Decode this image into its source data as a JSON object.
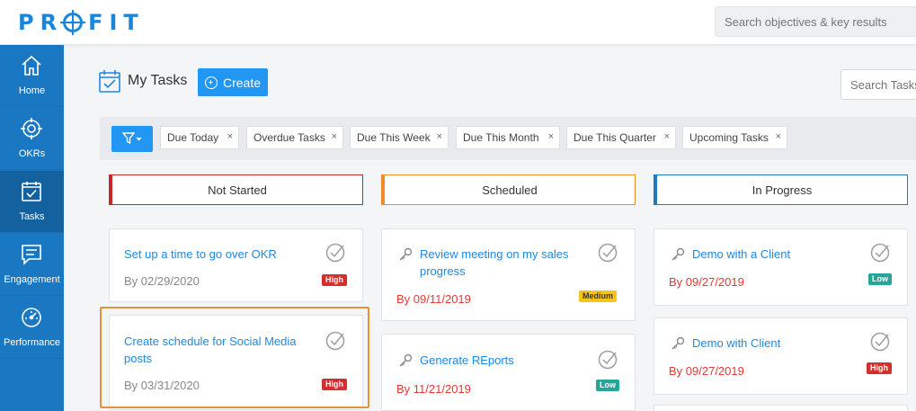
{
  "app": {
    "logo": "PROFIT"
  },
  "topbar": {
    "search_placeholder": "Search objectives & key results"
  },
  "sidebar": {
    "items": [
      {
        "label": "Home",
        "icon": "home-icon"
      },
      {
        "label": "OKRs",
        "icon": "target-icon"
      },
      {
        "label": "Tasks",
        "icon": "tasks-icon"
      },
      {
        "label": "Engagement",
        "icon": "chat-icon"
      },
      {
        "label": "Performance",
        "icon": "gauge-icon"
      }
    ]
  },
  "page": {
    "title": "My Tasks",
    "create_label": "Create",
    "search_placeholder": "Search Tasks"
  },
  "filters": [
    "Due Today",
    "Overdue Tasks",
    "Due This Week",
    "Due This Month",
    "Due This Quarter",
    "Upcoming Tasks"
  ],
  "filter_remove": "×",
  "columns": [
    {
      "name": "Not Started",
      "color": "#c62828"
    },
    {
      "name": "Scheduled",
      "color": "#ef8c2a"
    },
    {
      "name": "In Progress",
      "color": "#1e7bc2"
    }
  ],
  "cards": {
    "not_started": [
      {
        "title": "Set up a time to go over OKR",
        "date": "By 02/29/2020",
        "priority": "High"
      },
      {
        "title": "Create schedule for Social Media posts",
        "date": "By 03/31/2020",
        "priority": "High"
      }
    ],
    "scheduled": [
      {
        "title": "Review meeting on my sales progress",
        "date": "By 09/11/2019",
        "priority": "Medium"
      },
      {
        "title": "Generate REports",
        "date": "By 11/21/2019",
        "priority": "Low"
      }
    ],
    "in_progress": [
      {
        "title": "Demo with a Client",
        "date": "By 09/27/2019",
        "priority": "Low"
      },
      {
        "title": "Demo with Client",
        "date": "By 09/27/2019",
        "priority": "High"
      }
    ]
  }
}
